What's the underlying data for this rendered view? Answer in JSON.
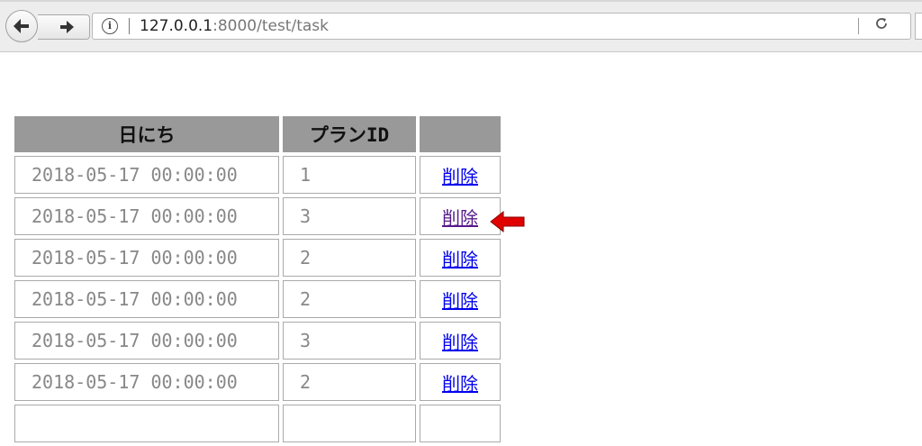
{
  "browser": {
    "url_host": "127.0.0.1",
    "url_rest": ":8000/test/task",
    "icons": [
      "back-arrow-icon",
      "forward-arrow-icon",
      "info-icon",
      "reload-icon"
    ]
  },
  "table": {
    "headers": {
      "date": "日にち",
      "plan_id": "プランID",
      "action": ""
    },
    "rows": [
      {
        "date": "2018-05-17 00:00:00",
        "plan_id": "1",
        "action": "削除"
      },
      {
        "date": "2018-05-17 00:00:00",
        "plan_id": "3",
        "action": "削除"
      },
      {
        "date": "2018-05-17 00:00:00",
        "plan_id": "2",
        "action": "削除"
      },
      {
        "date": "2018-05-17 00:00:00",
        "plan_id": "2",
        "action": "削除"
      },
      {
        "date": "2018-05-17 00:00:00",
        "plan_id": "3",
        "action": "削除"
      },
      {
        "date": "2018-05-17 00:00:00",
        "plan_id": "2",
        "action": "削除"
      }
    ]
  },
  "colors": {
    "header_bg": "#999999",
    "link": "#0000ee",
    "visited_link": "#551a8b",
    "annotation_arrow": "#e00000"
  },
  "annotation": {
    "icon": "red-left-arrow-icon",
    "points_to_row": 2
  }
}
